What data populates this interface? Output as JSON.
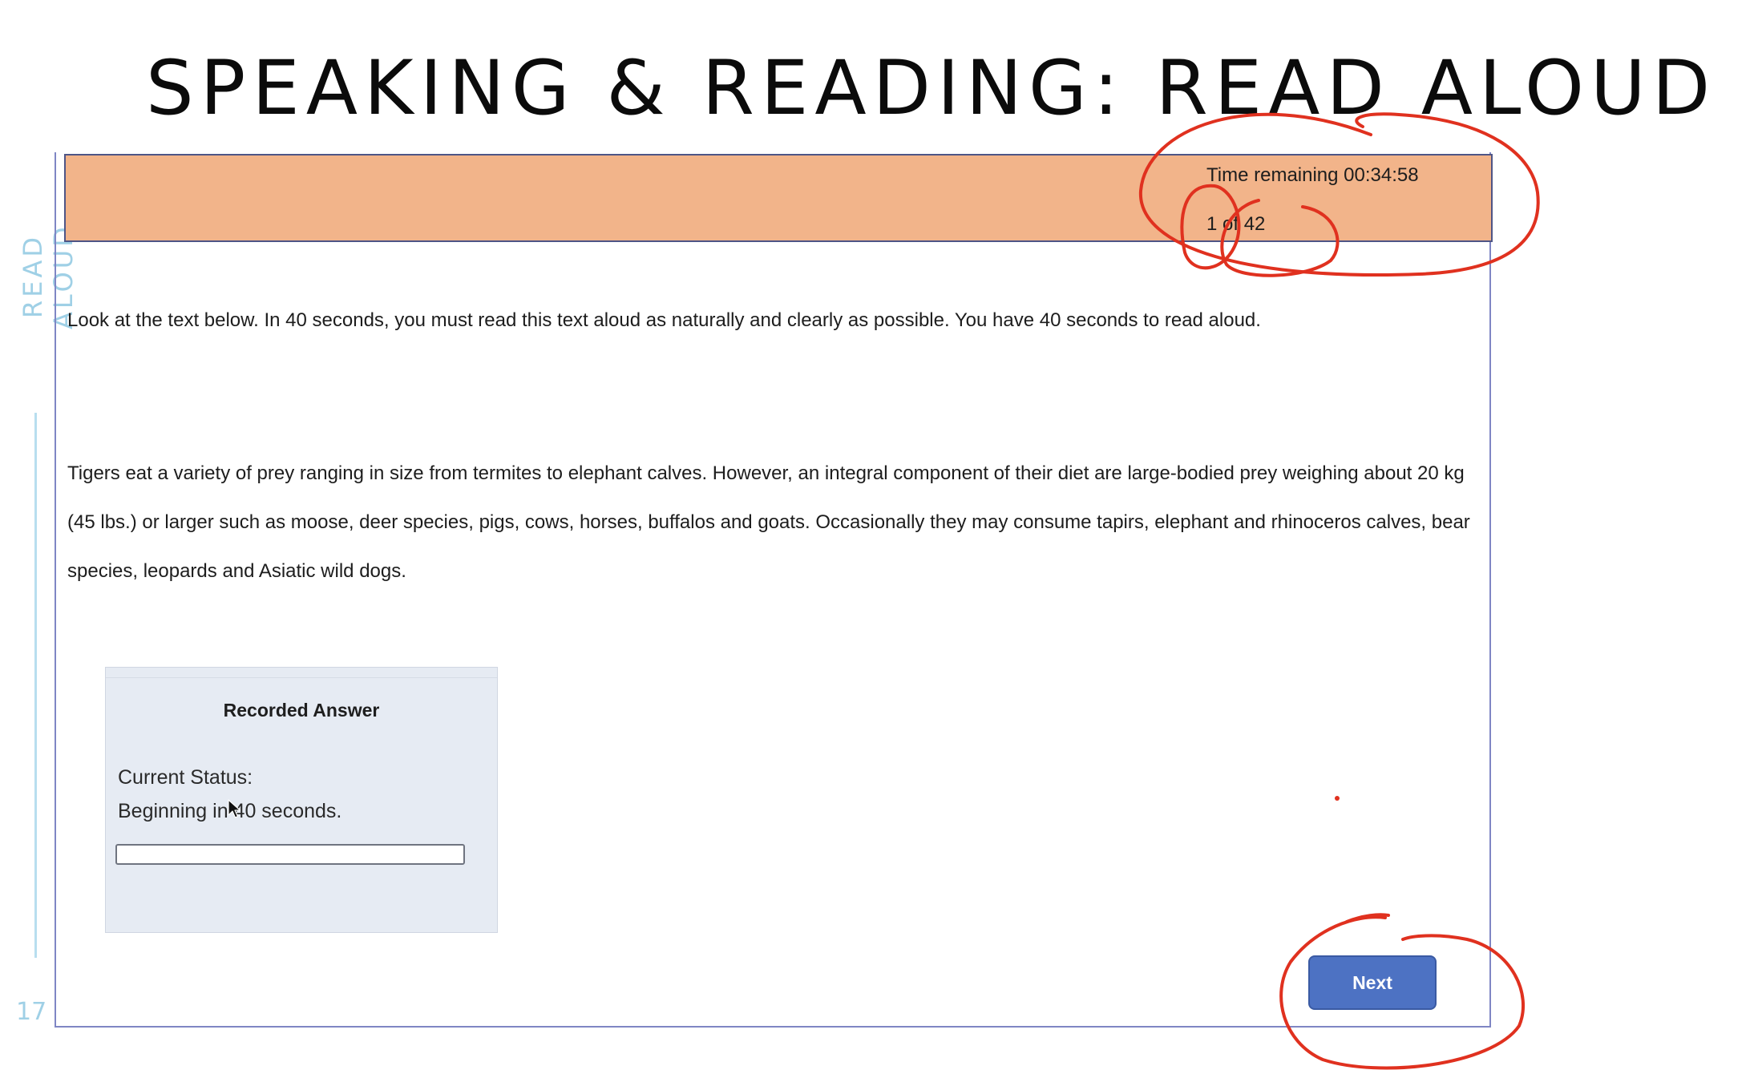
{
  "slide": {
    "title": "SPEAKING & READING: READ ALOUD",
    "side_label": "READ ALOUD",
    "page_number": "17"
  },
  "header": {
    "time_remaining": "Time remaining 00:34:58",
    "question_counter": "1 of 42",
    "background_color": "#f2b48a"
  },
  "content": {
    "instruction": "Look at the text below. In 40 seconds, you must read this text aloud as naturally and clearly as possible. You have 40 seconds to read aloud.",
    "passage": "Tigers eat a variety of prey ranging in size from termites to elephant calves. However, an integral component of their diet are large-bodied prey weighing about 20 kg (45 lbs.) or larger such as moose, deer species, pigs, cows, horses, buffalos and goats. Occasionally they may consume tapirs, elephant and rhinoceros calves, bear species, leopards and Asiatic wild dogs."
  },
  "recorder": {
    "title": "Recorded Answer",
    "status_label": "Current Status:",
    "status_value": "Beginning in 40 seconds.",
    "progress": 0
  },
  "navigation": {
    "next_label": "Next",
    "button_color": "#4d72c3"
  },
  "annotations": {
    "ink_color": "#e0311f",
    "icon": "cursor-arrow-icon"
  }
}
